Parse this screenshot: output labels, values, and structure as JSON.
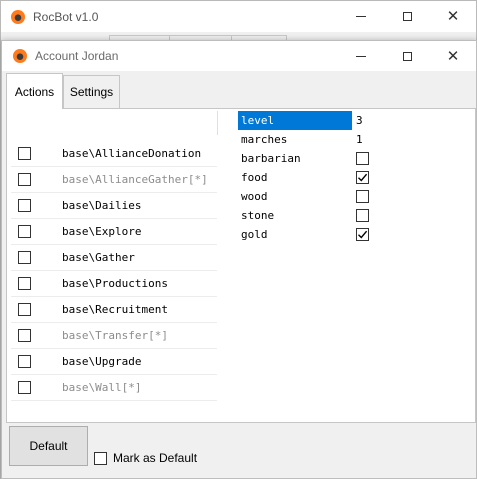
{
  "main_window": {
    "title": "RocBot v1.0"
  },
  "account_window": {
    "title": "Account Jordan",
    "tabs": [
      {
        "label": "Actions",
        "active": true
      },
      {
        "label": "Settings",
        "active": false
      }
    ],
    "tasks": [
      {
        "label": "base\\AllianceDonation",
        "checked": false,
        "enabled": true
      },
      {
        "label": "base\\AllianceGather[*]",
        "checked": false,
        "enabled": false
      },
      {
        "label": "base\\Dailies",
        "checked": false,
        "enabled": true
      },
      {
        "label": "base\\Explore",
        "checked": false,
        "enabled": true
      },
      {
        "label": "base\\Gather",
        "checked": false,
        "enabled": true
      },
      {
        "label": "base\\Productions",
        "checked": false,
        "enabled": true
      },
      {
        "label": "base\\Recruitment",
        "checked": false,
        "enabled": true
      },
      {
        "label": "base\\Transfer[*]",
        "checked": false,
        "enabled": false
      },
      {
        "label": "base\\Upgrade",
        "checked": false,
        "enabled": true
      },
      {
        "label": "base\\Wall[*]",
        "checked": false,
        "enabled": false
      }
    ],
    "properties": [
      {
        "name": "level",
        "type": "text",
        "value": "3",
        "selected": true
      },
      {
        "name": "marches",
        "type": "text",
        "value": "1",
        "selected": false
      },
      {
        "name": "barbarian",
        "type": "checkbox",
        "checked": false,
        "selected": false
      },
      {
        "name": "food",
        "type": "checkbox",
        "checked": true,
        "selected": false
      },
      {
        "name": "wood",
        "type": "checkbox",
        "checked": false,
        "selected": false
      },
      {
        "name": "stone",
        "type": "checkbox",
        "checked": false,
        "selected": false
      },
      {
        "name": "gold",
        "type": "checkbox",
        "checked": true,
        "selected": false
      }
    ],
    "default_button": "Default",
    "mark_as_default": {
      "label": "Mark as Default",
      "checked": false
    }
  },
  "colors": {
    "selection": "#0078d7",
    "disabled_text": "#8c8c8c",
    "window_bg": "#f0f0f0"
  }
}
